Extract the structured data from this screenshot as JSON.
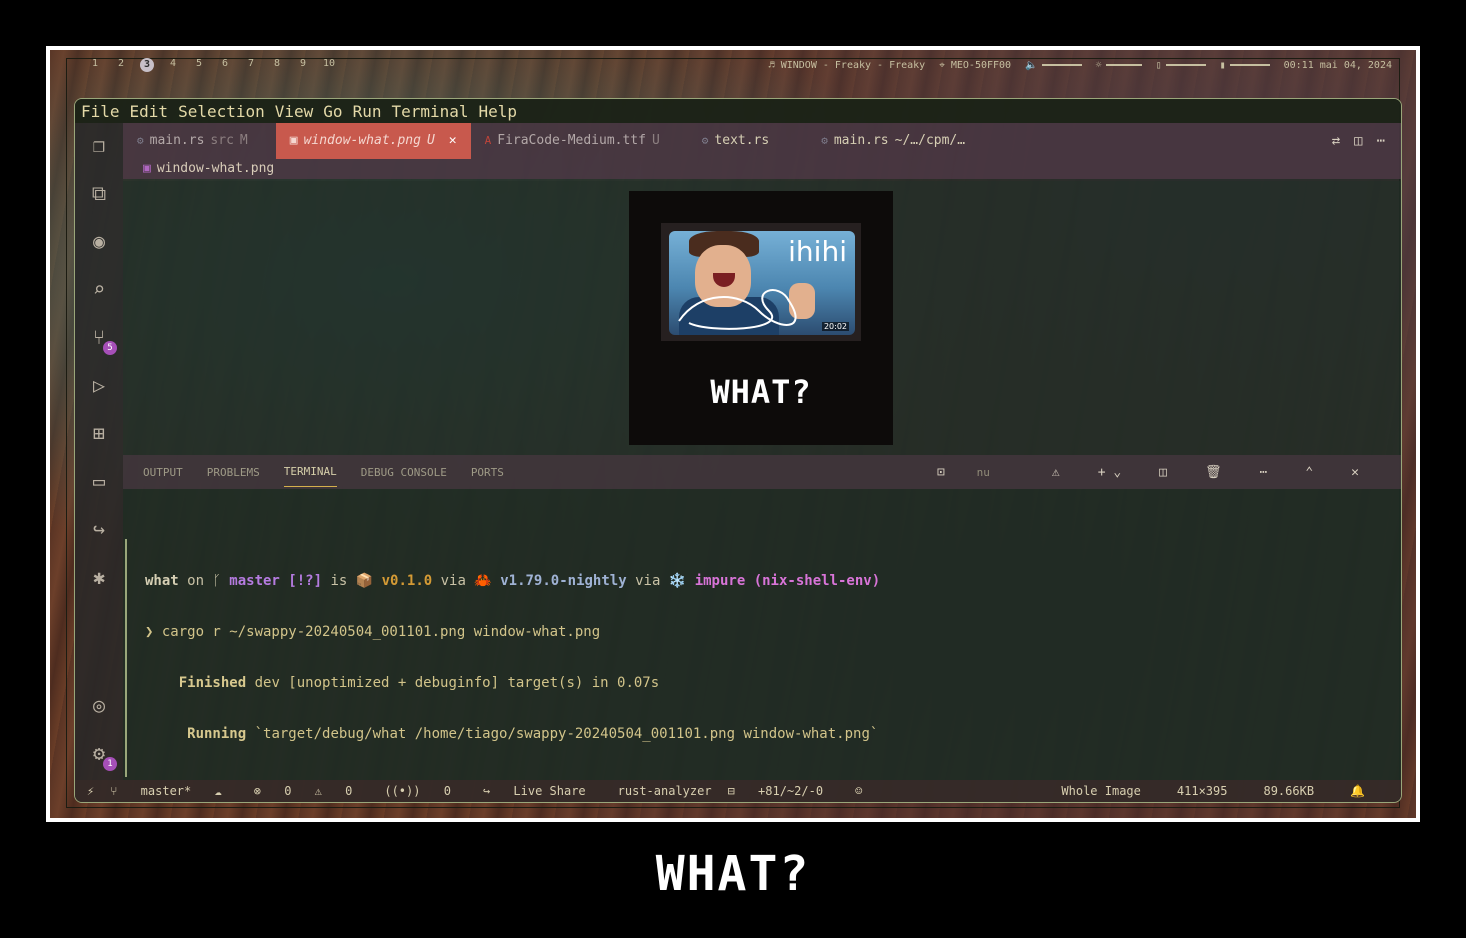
{
  "waybar": {
    "workspaces": [
      "1",
      "2",
      "3",
      "4",
      "5",
      "6",
      "7",
      "8",
      "9",
      "10"
    ],
    "active_workspace": "3",
    "window_title": "♬ WINDOW - Freaky - Freaky",
    "wifi": "⌖ MEO-50FF00",
    "volume_icon": "🔈",
    "brightness_icon": "☼",
    "battery_icon": "▮",
    "disk_icon": "▯",
    "clock": "00:11 mai 04, 2024"
  },
  "menubar": [
    "File",
    "Edit",
    "Selection",
    "View",
    "Go",
    "Run",
    "Terminal",
    "Help"
  ],
  "activity_badges": {
    "source_control": "5",
    "settings": "1"
  },
  "tabs": [
    {
      "name": "main.rs",
      "detail": "src",
      "status": "M",
      "icon": "rust-icon"
    },
    {
      "name": "window-what.png",
      "detail": "",
      "status": "U",
      "icon": "image-icon",
      "active": true
    },
    {
      "name": "FiraCode-Medium.ttf",
      "detail": "",
      "status": "U",
      "icon": "font-icon"
    },
    {
      "name": "text.rs",
      "detail": "",
      "status": "",
      "icon": "rust-icon"
    },
    {
      "name": "main.rs",
      "detail": "~/…/cpm/…",
      "status": "",
      "icon": "rust-icon"
    }
  ],
  "breadcrumb": "window-what.png",
  "preview": {
    "meme_text": "ihihi",
    "timestamp": "20:02",
    "caption": "WHAT?"
  },
  "panel": {
    "tabs": [
      "OUTPUT",
      "PROBLEMS",
      "TERMINAL",
      "DEBUG CONSOLE",
      "PORTS"
    ],
    "active_tab": "TERMINAL",
    "shell": "nu"
  },
  "terminal": {
    "prompt1": {
      "dir": "what",
      "on": " on ",
      "branch_icon": "ᚴ ",
      "branch": "master",
      "status": " [!?]",
      "is": " is ",
      "pkg_icon": "📦 ",
      "version": "v0.1.0",
      "via": " via ",
      "rust_icon": "🦀 ",
      "rust": "v1.79.0-nightly",
      "via2": " via ",
      "nix_icon": "❄️ ",
      "nix": "impure (nix-shell-env)"
    },
    "command": "❯ cargo r ~/swappy-20240504_001101.png window-what.png",
    "finished_label": "    Finished",
    "finished_text": " dev [unoptimized + debuginfo] target(s) in 0.07s",
    "running_label": "     Running",
    "running_text": " `target/debug/what /home/tiago/swappy-20240504_001101.png window-what.png`",
    "prompt_char": "❯ "
  },
  "statusbar": {
    "branch": "master*",
    "errors": "0",
    "warnings": "0",
    "ports": "0",
    "live_share": "Live Share",
    "analyzer": "rust-analyzer",
    "changes": "+81/~2/-0",
    "image_mode": "Whole Image",
    "dimensions": "411×395",
    "size": "89.66KB"
  },
  "caption": "WHAT?"
}
